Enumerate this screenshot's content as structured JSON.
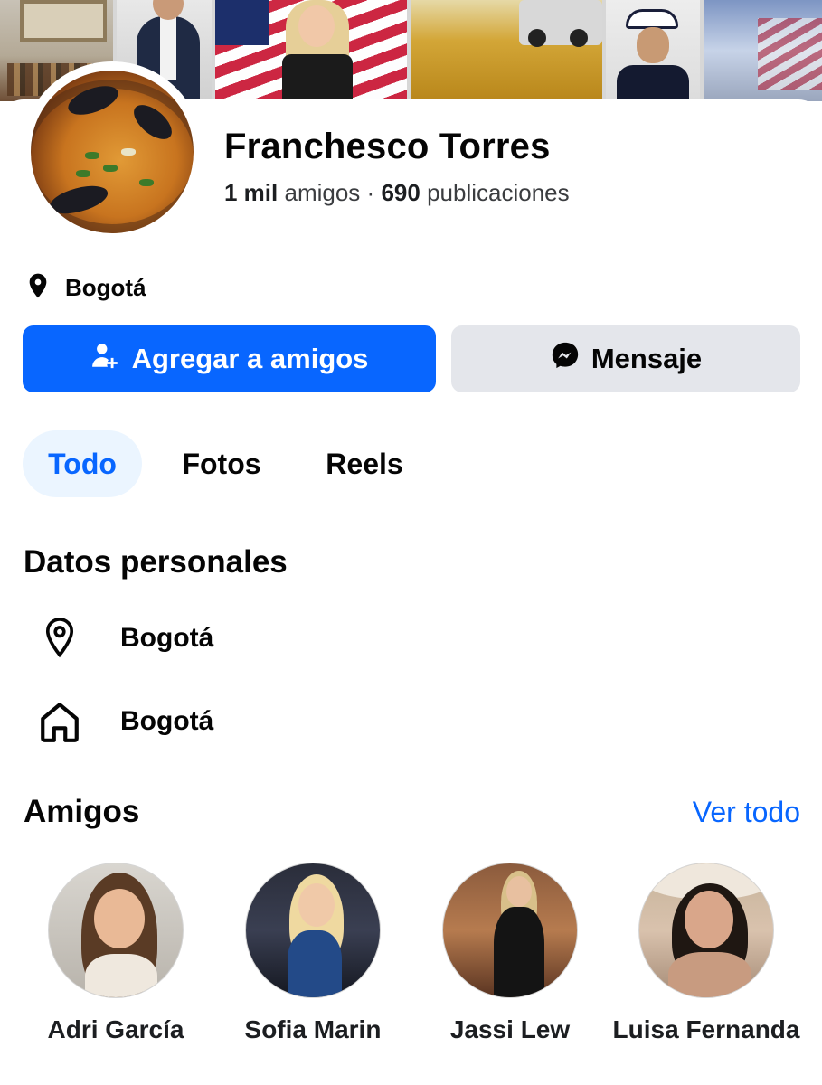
{
  "profile": {
    "name": "Franchesco Torres",
    "friends_count": "1 mil",
    "friends_label": "amigos",
    "separator": "·",
    "posts_count": "690",
    "posts_label": "publicaciones",
    "location": "Bogotá"
  },
  "actions": {
    "add_friend_label": "Agregar a amigos",
    "message_label": "Mensaje"
  },
  "tabs": [
    {
      "label": "Todo",
      "active": true
    },
    {
      "label": "Fotos",
      "active": false
    },
    {
      "label": "Reels",
      "active": false
    }
  ],
  "personal_details": {
    "title": "Datos personales",
    "items": [
      {
        "icon": "location-pin-icon",
        "text": "Bogotá"
      },
      {
        "icon": "home-icon",
        "text": "Bogotá"
      }
    ]
  },
  "friends": {
    "title": "Amigos",
    "see_all_label": "Ver todo",
    "items": [
      {
        "name": "Adri García"
      },
      {
        "name": "Sofia Marin"
      },
      {
        "name": "Jassi Lew"
      },
      {
        "name": "Luisa Fernanda"
      }
    ]
  },
  "colors": {
    "primary_blue": "#0866ff",
    "secondary_button": "#e4e6eb",
    "active_tab_bg": "#ebf5ff",
    "text_primary": "#050505"
  }
}
